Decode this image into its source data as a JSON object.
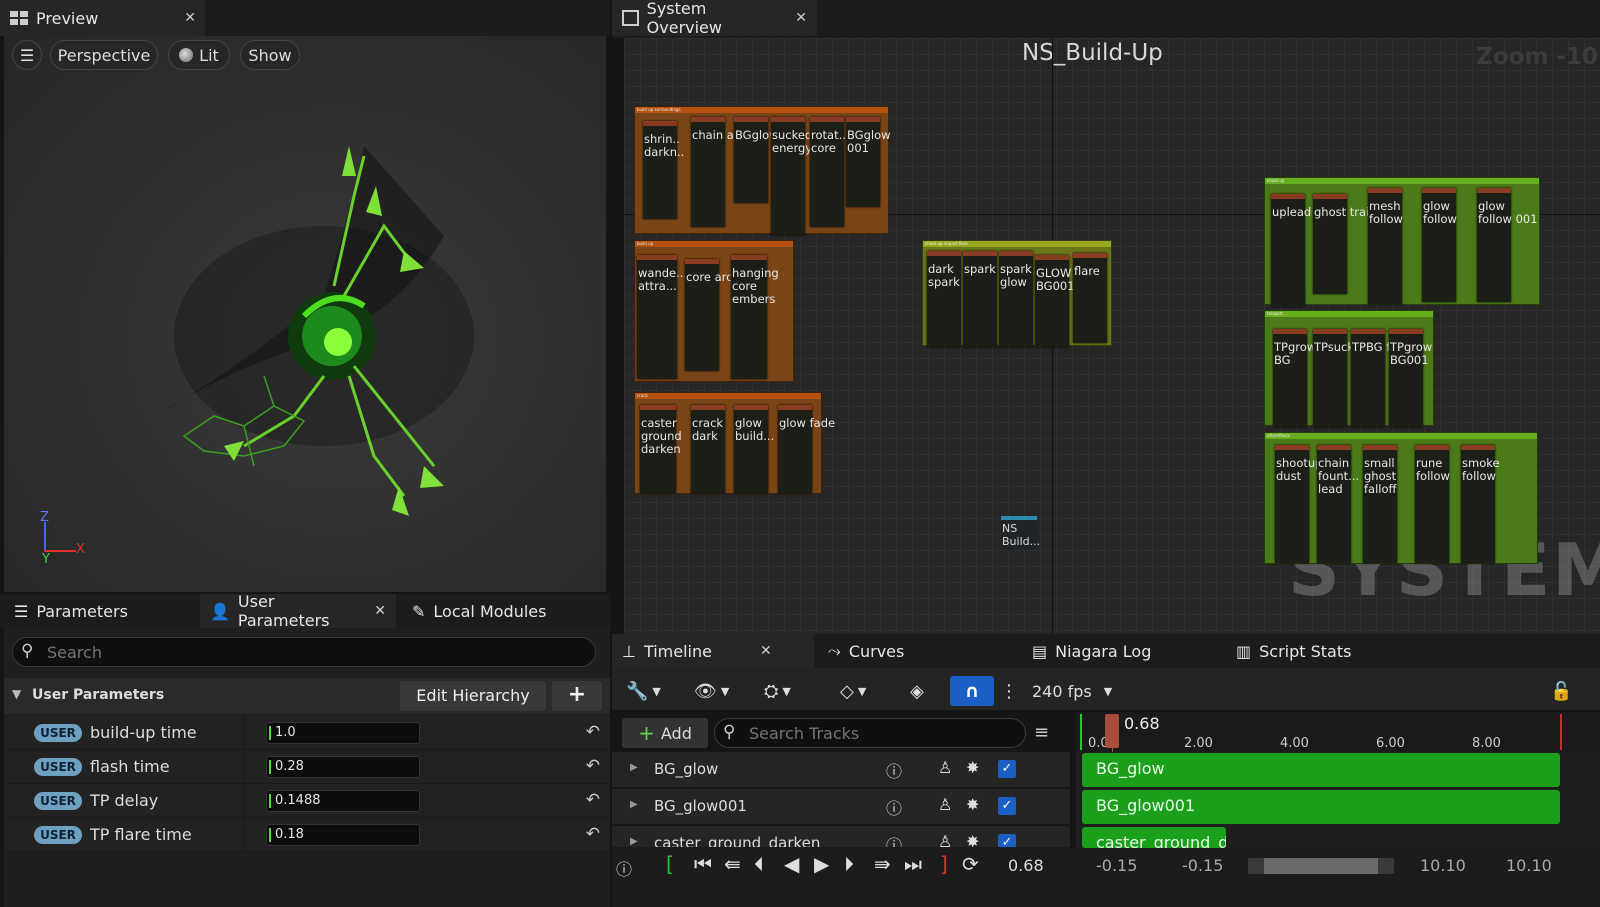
{
  "preview": {
    "tab_label": "Preview",
    "buttons": {
      "perspective": "Perspective",
      "lit": "Lit",
      "show": "Show"
    },
    "axes": {
      "z": "Z",
      "y": "Y",
      "x": "X"
    }
  },
  "system_overview": {
    "tab_label": "System Overview",
    "title": "NS_Build-Up",
    "zoom": "Zoom -10",
    "watermark": "SYSTEM",
    "system_node": "NS Build..."
  },
  "groups": [
    {
      "title": "build up surroundings",
      "emitters": [
        "shrin.. darkn..",
        "chain arcs",
        "BGglow",
        "sucked energy",
        "rotat... core",
        "BGglow 001"
      ]
    },
    {
      "title": "build up",
      "emitters": [
        "wande... attra...",
        "core arcs",
        "hanging core embers"
      ]
    },
    {
      "title": "crack",
      "emitters": [
        "caster ground darken",
        "crack dark",
        "glow build...",
        "glow fade"
      ]
    },
    {
      "title": "shoot up impact flare",
      "emitters": [
        "dark spark",
        "spark",
        "spark glow",
        "GLOW BG001",
        "flare"
      ]
    },
    {
      "title": "shoot up",
      "emitters": [
        "uplead",
        "ghost trail",
        "mesh follow",
        "glow follow",
        "glow follow 001"
      ]
    },
    {
      "title": "teleport",
      "emitters": [
        "TPgrow BG",
        "TPsuck",
        "TPBG flat",
        "TPgrow BG001"
      ]
    },
    {
      "title": "aftereffects",
      "emitters": [
        "shootup dust",
        "chain fount... lead",
        "small ghost falloff",
        "rune follow",
        "smoke follow"
      ]
    }
  ],
  "params_panel": {
    "tabs": [
      "Parameters",
      "User Parameters",
      "Local Modules"
    ],
    "search_placeholder": "Search",
    "section_title": "User Parameters",
    "edit_hierarchy": "Edit Hierarchy",
    "add_symbol": "+",
    "badge": "USER",
    "rows": [
      {
        "name": "build-up time",
        "value": "1.0"
      },
      {
        "name": "flash time",
        "value": "0.28"
      },
      {
        "name": "TP delay",
        "value": "0.1488"
      },
      {
        "name": "TP flare time",
        "value": "0.18"
      }
    ]
  },
  "timeline": {
    "tabs": [
      "Timeline",
      "Curves",
      "Niagara Log",
      "Script Stats"
    ],
    "fps": "240 fps",
    "add_label": "Add",
    "search_placeholder": "Search Tracks",
    "playhead": "0.68",
    "ticks": [
      "0.00",
      "2.00",
      "4.00",
      "6.00",
      "8.00"
    ],
    "tracks": [
      "BG_glow",
      "BG_glow001",
      "caster_ground_darken"
    ],
    "bar_labels": [
      "BG_glow",
      "BG_glow001",
      "caster_ground_da..."
    ],
    "current_time": "0.68",
    "range": [
      "-0.15",
      "-0.15",
      "10.10",
      "10.10"
    ]
  },
  "colors": {
    "orange_group": "#7a4516",
    "lime_group": "#6a7718",
    "green_group": "#4c7a18",
    "track_bar": "#1aa01a",
    "accent_blue": "#1a5fc4"
  }
}
